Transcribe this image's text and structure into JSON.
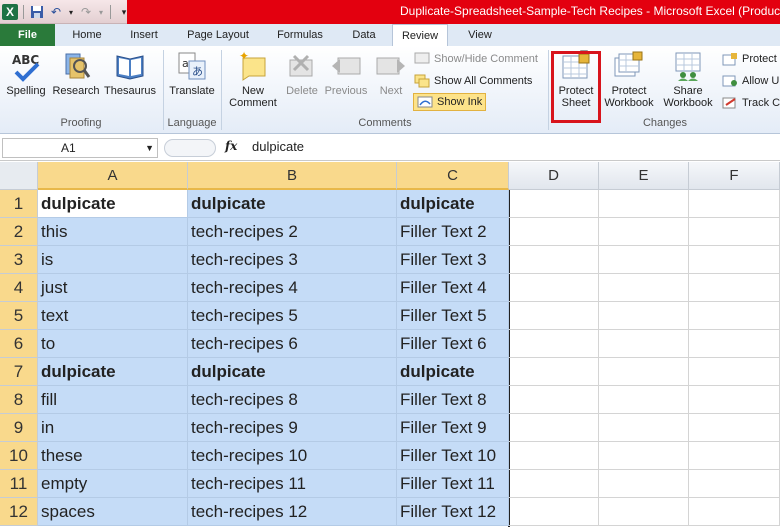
{
  "window": {
    "title": "Duplicate-Spreadsheet-Sample-Tech Recipes  -  Microsoft Excel (Product"
  },
  "qat": {
    "icons": [
      "excel-icon",
      "save-icon",
      "undo-icon",
      "redo-icon",
      "customize-icon"
    ]
  },
  "tabs": [
    "File",
    "Home",
    "Insert",
    "Page Layout",
    "Formulas",
    "Data",
    "Review",
    "View"
  ],
  "active_tab": "Review",
  "ribbon": {
    "proofing": {
      "label": "Proofing",
      "spelling": "Spelling",
      "research": "Research",
      "thesaurus": "Thesaurus"
    },
    "language": {
      "label": "Language",
      "translate": "Translate"
    },
    "comments": {
      "label": "Comments",
      "new_comment_1": "New",
      "new_comment_2": "Comment",
      "delete": "Delete",
      "previous": "Previous",
      "next": "Next",
      "show_hide": "Show/Hide Comment",
      "show_all": "Show All Comments",
      "show_ink": "Show Ink"
    },
    "changes": {
      "label": "Changes",
      "protect_sheet_1": "Protect",
      "protect_sheet_2": "Sheet",
      "protect_workbook_1": "Protect",
      "protect_workbook_2": "Workbook",
      "share_workbook_1": "Share",
      "share_workbook_2": "Workbook",
      "protect_shared": "Protect",
      "allow_users": "Allow U",
      "track_changes": "Track Ch"
    }
  },
  "formula_bar": {
    "name_box": "A1",
    "fx": "fx",
    "value": "dulpicate"
  },
  "columns": [
    "A",
    "B",
    "C",
    "D",
    "E",
    "F"
  ],
  "rows": [
    {
      "n": "1",
      "a": "dulpicate",
      "b": "dulpicate",
      "c": "dulpicate",
      "bold": true
    },
    {
      "n": "2",
      "a": "this",
      "b": "tech-recipes 2",
      "c": "Filler Text 2",
      "bold": false
    },
    {
      "n": "3",
      "a": "is",
      "b": "tech-recipes  3",
      "c": "Filler Text 3",
      "bold": false
    },
    {
      "n": "4",
      "a": "just",
      "b": "tech-recipes 4",
      "c": "Filler Text 4",
      "bold": false
    },
    {
      "n": "5",
      "a": "text",
      "b": "tech-recipes  5",
      "c": "Filler Text 5",
      "bold": false
    },
    {
      "n": "6",
      "a": "to",
      "b": "tech-recipes  6",
      "c": "Filler Text 6",
      "bold": false
    },
    {
      "n": "7",
      "a": "dulpicate",
      "b": "dulpicate",
      "c": "dulpicate",
      "bold": true
    },
    {
      "n": "8",
      "a": "fill",
      "b": "tech-recipes  8",
      "c": "Filler Text 8",
      "bold": false
    },
    {
      "n": "9",
      "a": "in",
      "b": "tech-recipes 9",
      "c": "Filler Text 9",
      "bold": false
    },
    {
      "n": "10",
      "a": "these",
      "b": "tech-recipes  10",
      "c": "Filler Text 10",
      "bold": false
    },
    {
      "n": "11",
      "a": "empty",
      "b": "tech-recipes  11",
      "c": "Filler Text 11",
      "bold": false
    },
    {
      "n": "12",
      "a": "spaces",
      "b": "tech-recipes 12",
      "c": "Filler Text 12",
      "bold": false
    }
  ],
  "colors": {
    "accent_red": "#e3000f",
    "file_tab": "#2a7a3a",
    "selection": "#c5dcf7",
    "header_selected": "#f9d98c",
    "highlight_box": "#d8141c"
  }
}
